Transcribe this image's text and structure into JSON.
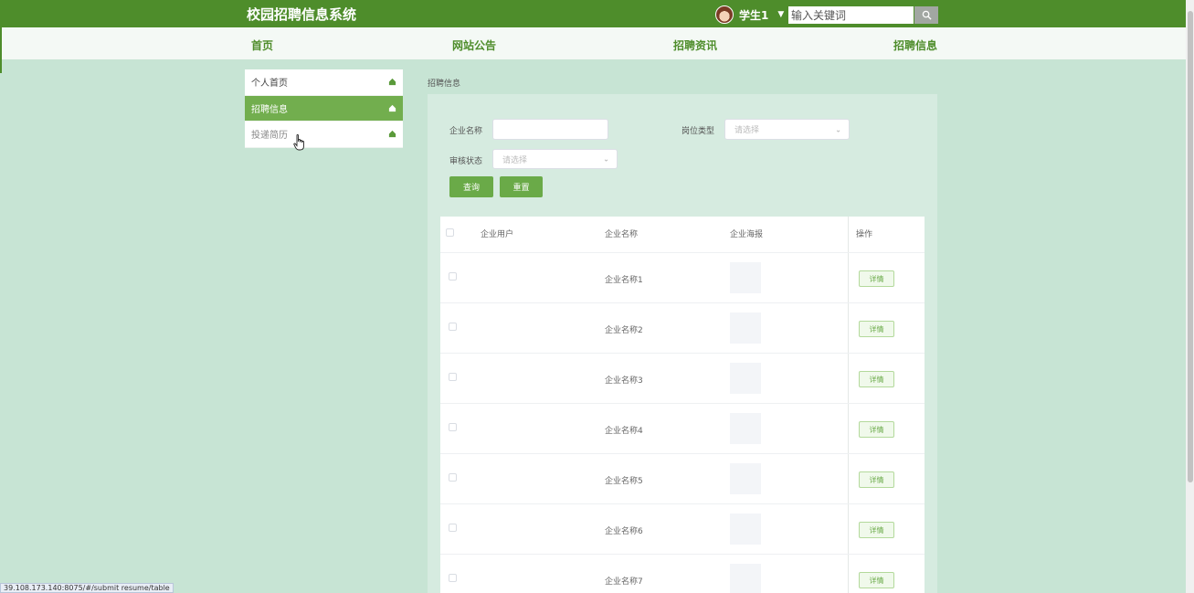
{
  "header": {
    "site_title": "校园招聘信息系统",
    "user_name": "学生1",
    "search_placeholder": "输入关键词"
  },
  "nav": [
    "首页",
    "网站公告",
    "招聘资讯",
    "招聘信息"
  ],
  "sidebar": {
    "items": [
      {
        "label": "个人首页",
        "active": false
      },
      {
        "label": "招聘信息",
        "active": true
      },
      {
        "label": "投递简历",
        "active": false
      }
    ]
  },
  "breadcrumb": "招聘信息",
  "filters": {
    "company_name_label": "企业名称",
    "job_type_label": "岗位类型",
    "job_type_placeholder": "请选择",
    "audit_status_label": "审核状态",
    "audit_status_placeholder": "请选择",
    "query_button": "查询",
    "reset_button": "重置"
  },
  "table": {
    "columns": [
      "企业用户",
      "企业名称",
      "企业海报",
      "操作"
    ],
    "rows": [
      {
        "company_user": "",
        "company_name": "企业名称1",
        "action": "详情"
      },
      {
        "company_user": "",
        "company_name": "企业名称2",
        "action": "详情"
      },
      {
        "company_user": "",
        "company_name": "企业名称3",
        "action": "详情"
      },
      {
        "company_user": "",
        "company_name": "企业名称4",
        "action": "详情"
      },
      {
        "company_user": "",
        "company_name": "企业名称5",
        "action": "详情"
      },
      {
        "company_user": "",
        "company_name": "企业名称6",
        "action": "详情"
      },
      {
        "company_user": "",
        "company_name": "企业名称7",
        "action": "详情"
      }
    ]
  },
  "status_bar_url": "39.108.173.140:8075/#/submit resume/table",
  "colors": {
    "header_green": "#4e8d2b",
    "active_menu": "#72ae4e",
    "page_background": "#c7e4d4",
    "button_green": "#6aaa48"
  }
}
